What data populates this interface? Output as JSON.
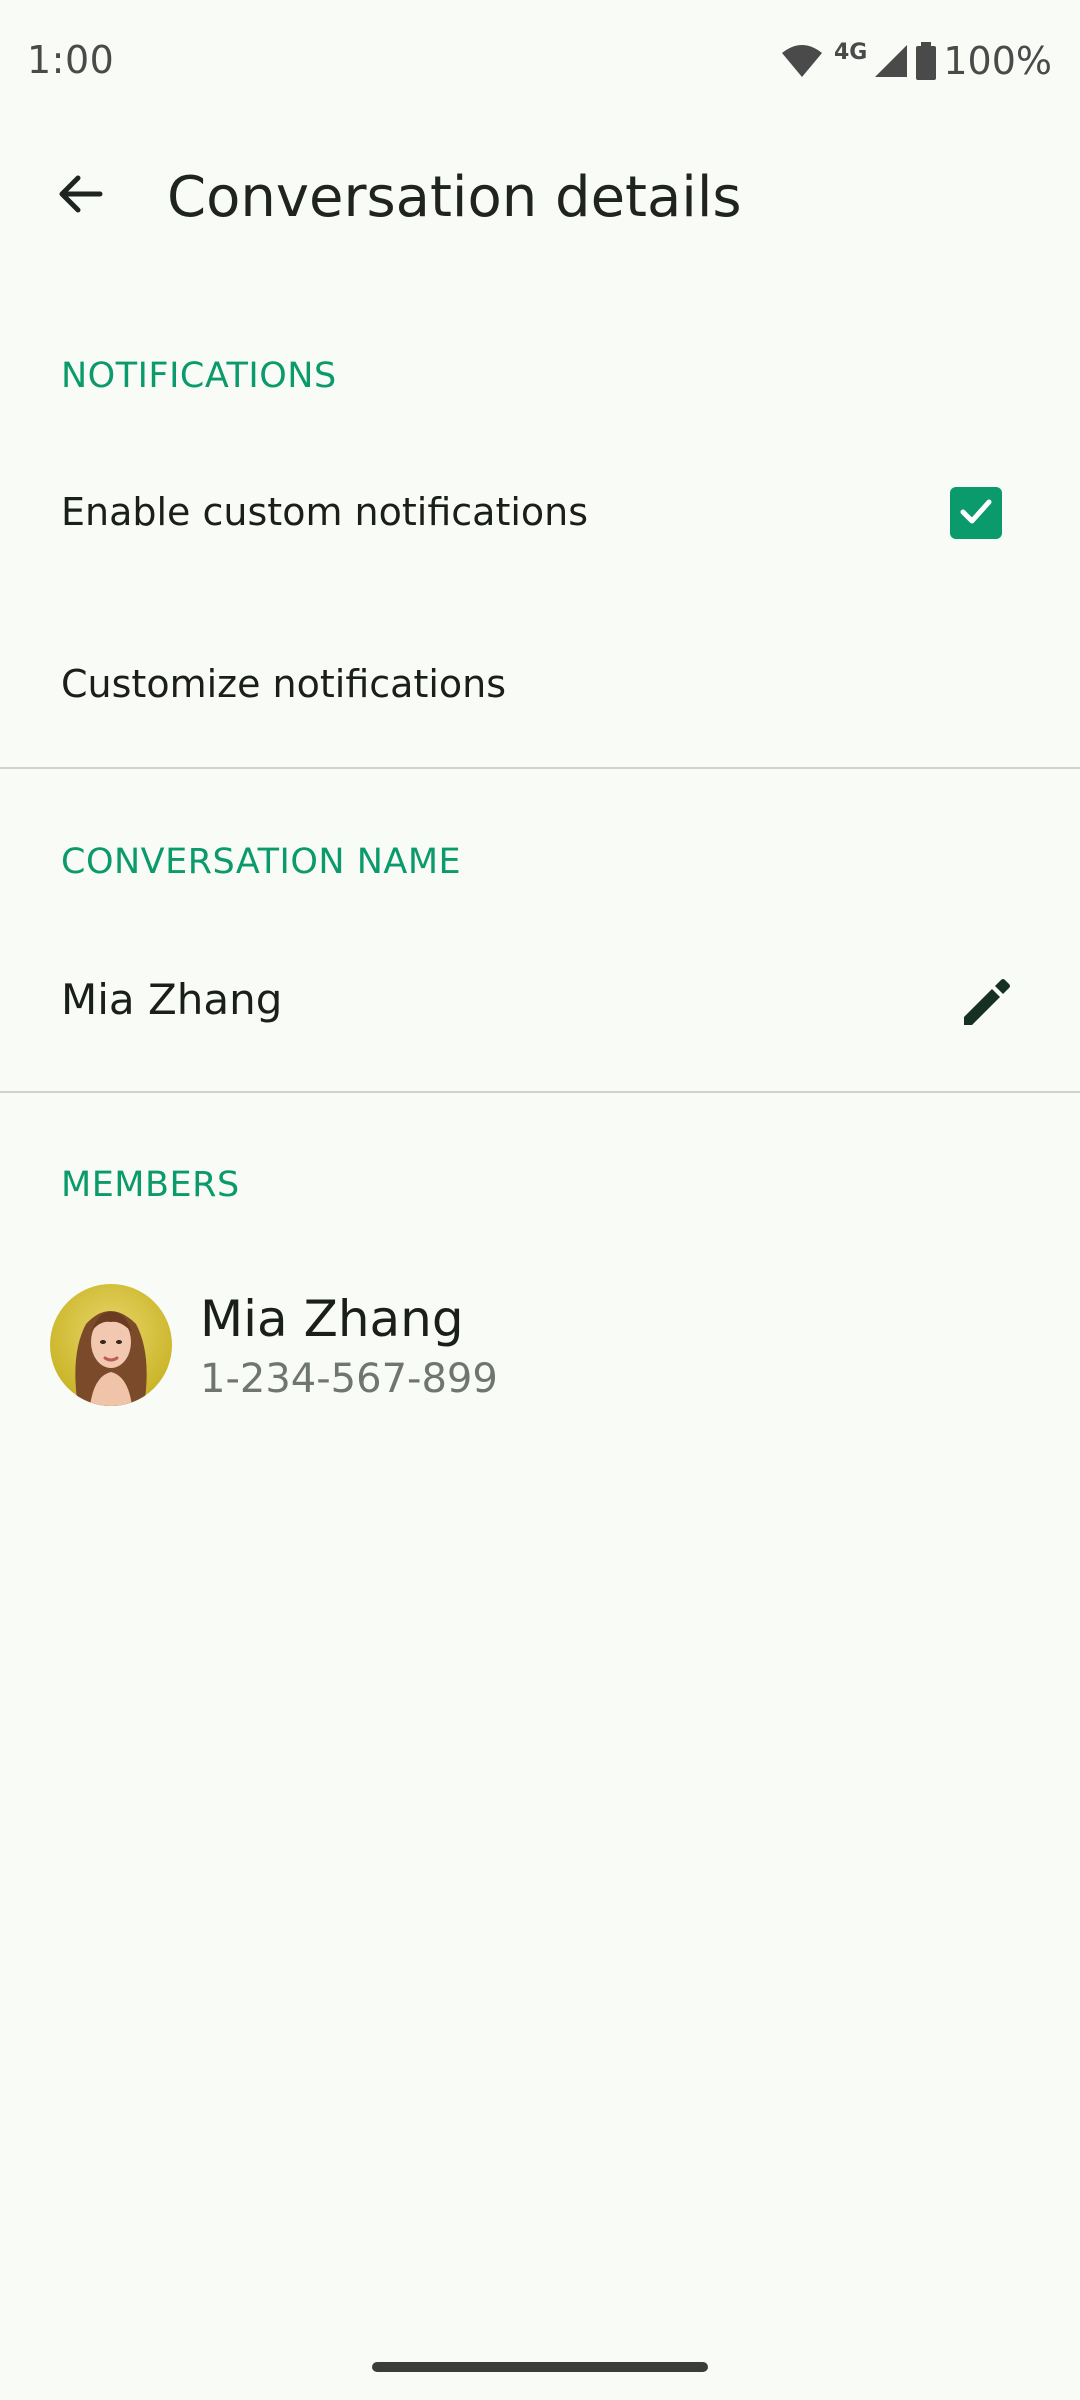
{
  "status_bar": {
    "time": "1:00",
    "network": "4G",
    "battery": "100%"
  },
  "app_bar": {
    "title": "Conversation details"
  },
  "notifications": {
    "header": "NOTIFICATIONS",
    "enable_label": "Enable custom notifications",
    "enable_checked": true,
    "customize_label": "Customize notifications"
  },
  "conversation_name": {
    "header": "CONVERSATION NAME",
    "value": "Mia Zhang"
  },
  "members": {
    "header": "MEMBERS",
    "items": [
      {
        "name": "Mia Zhang",
        "phone": "1-234-567-899"
      }
    ]
  },
  "colors": {
    "accent": "#0a9a6c",
    "background": "#f9fbf7"
  }
}
